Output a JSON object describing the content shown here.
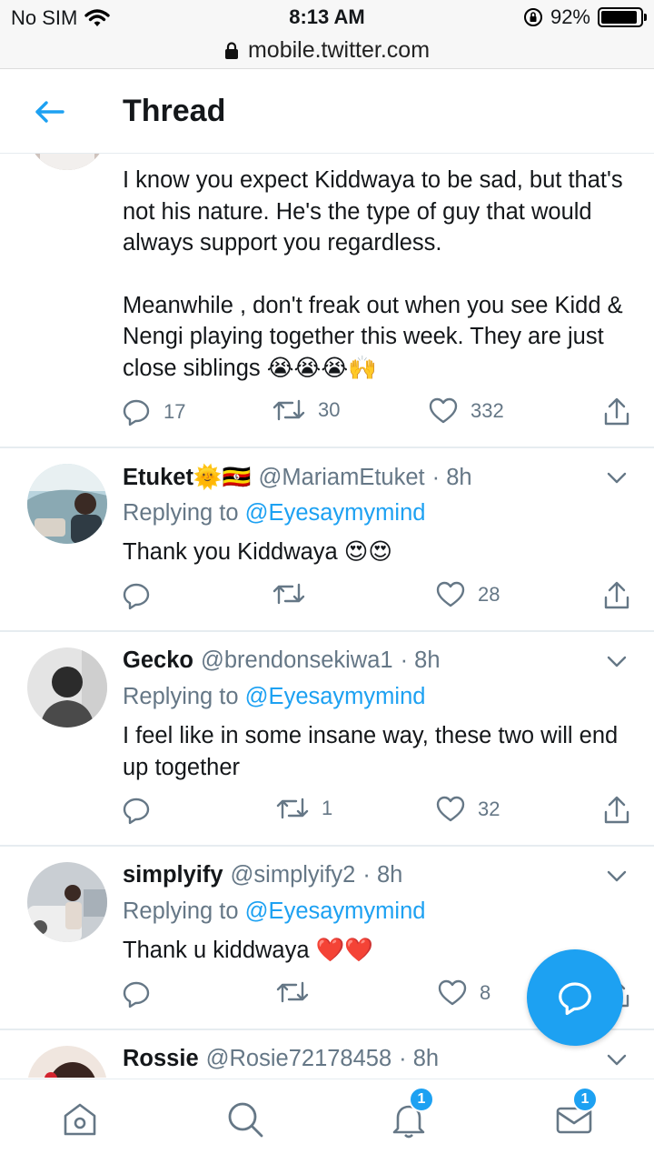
{
  "status_bar": {
    "carrier": "No SIM",
    "time": "8:13 AM",
    "battery": "92%",
    "battery_level": 0.92
  },
  "browser": {
    "url": "mobile.twitter.com"
  },
  "header": {
    "title": "Thread"
  },
  "main_tweet": {
    "paragraphs": [
      "I know you expect Kiddwaya to be sad, but that's not his nature. He's the type of guy that would always support you regardless.",
      "Meanwhile , don't freak out when you see Kidd & Nengi playing together this week. They are just close siblings 😭😭😭🙌"
    ],
    "replies": "17",
    "retweets": "30",
    "likes": "332"
  },
  "replies": [
    {
      "name": "Etuket🌞🇺🇬",
      "handle": "@MariamEtuket",
      "time": "· 8h",
      "replying_prefix": "Replying to",
      "replying_to": "@Eyesaymymind",
      "text": "Thank you Kiddwaya 😍😍",
      "replies": "",
      "retweets": "",
      "likes": "28"
    },
    {
      "name": "Gecko",
      "handle": "@brendonsekiwa1",
      "time": "· 8h",
      "replying_prefix": "Replying to",
      "replying_to": "@Eyesaymymind",
      "text": "I feel like in some insane way, these two will end up together",
      "replies": "",
      "retweets": "1",
      "likes": "32"
    },
    {
      "name": "simplyify",
      "handle": "@simplyify2",
      "time": "· 8h",
      "replying_prefix": "Replying to",
      "replying_to": "@Eyesaymymind",
      "text": "Thank u kiddwaya ❤️❤️",
      "replies": "",
      "retweets": "",
      "likes": "8"
    },
    {
      "name": "Rossie",
      "handle": "@Rosie72178458",
      "time": "· 8h"
    }
  ],
  "nav": {
    "notifications_badge": "1",
    "messages_badge": "1"
  },
  "colors": {
    "accent": "#1da1f2",
    "text": "#14171a",
    "muted": "#657786",
    "divider": "#e6ecf0"
  }
}
